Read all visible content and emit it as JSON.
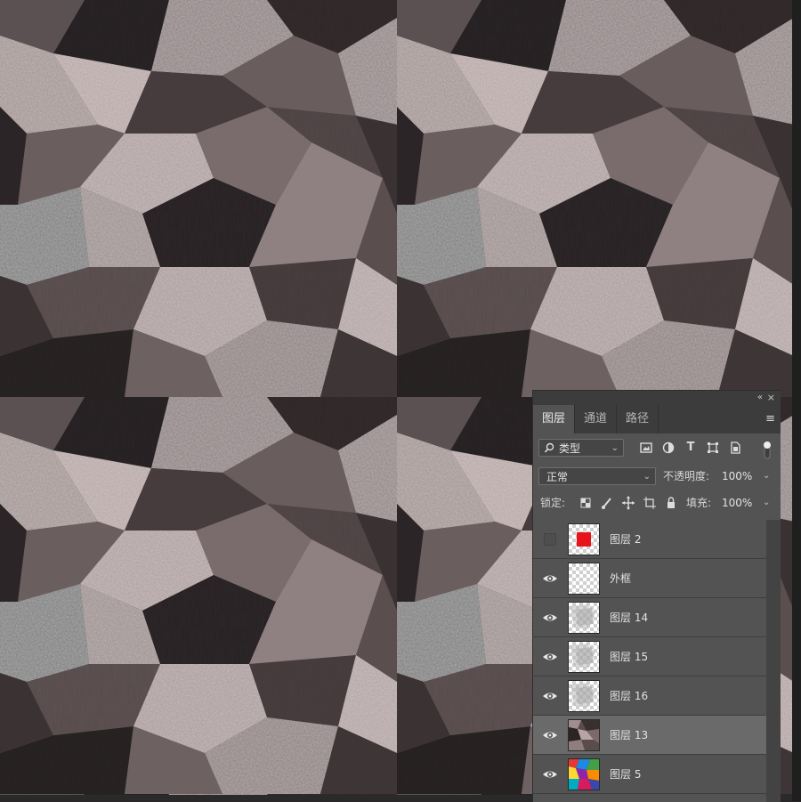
{
  "panel": {
    "tabs": [
      {
        "label": "图层",
        "active": true
      },
      {
        "label": "通道",
        "active": false
      },
      {
        "label": "路径",
        "active": false
      }
    ],
    "collapse_icon": "«",
    "close_icon": "×",
    "menu_icon": "≡",
    "filter": {
      "label": "类型",
      "icon": "search-icon"
    },
    "blend_mode": "正常",
    "opacity_label": "不透明度:",
    "opacity_value": "100%",
    "lock_label": "锁定:",
    "fill_label": "填充:",
    "fill_value": "100%",
    "layers": [
      {
        "name": "图层 2",
        "visible": false,
        "thumb": "red",
        "selected": false
      },
      {
        "name": "外框",
        "visible": true,
        "thumb": "transparent",
        "selected": false
      },
      {
        "name": "图层 14",
        "visible": true,
        "thumb": "texture-light",
        "selected": false
      },
      {
        "name": "图层 15",
        "visible": true,
        "thumb": "texture-light",
        "selected": false
      },
      {
        "name": "图层 16",
        "visible": true,
        "thumb": "texture-light",
        "selected": false
      },
      {
        "name": "图层 13",
        "visible": true,
        "thumb": "texture-dark",
        "selected": true
      },
      {
        "name": "图层 5",
        "visible": true,
        "thumb": "colorful",
        "selected": false
      }
    ]
  },
  "colors": {
    "panel_bg": "#535353",
    "tab_bar": "#3c3c3c",
    "selected_layer": "#6a6a6a",
    "accent_red": "#e8141b"
  }
}
